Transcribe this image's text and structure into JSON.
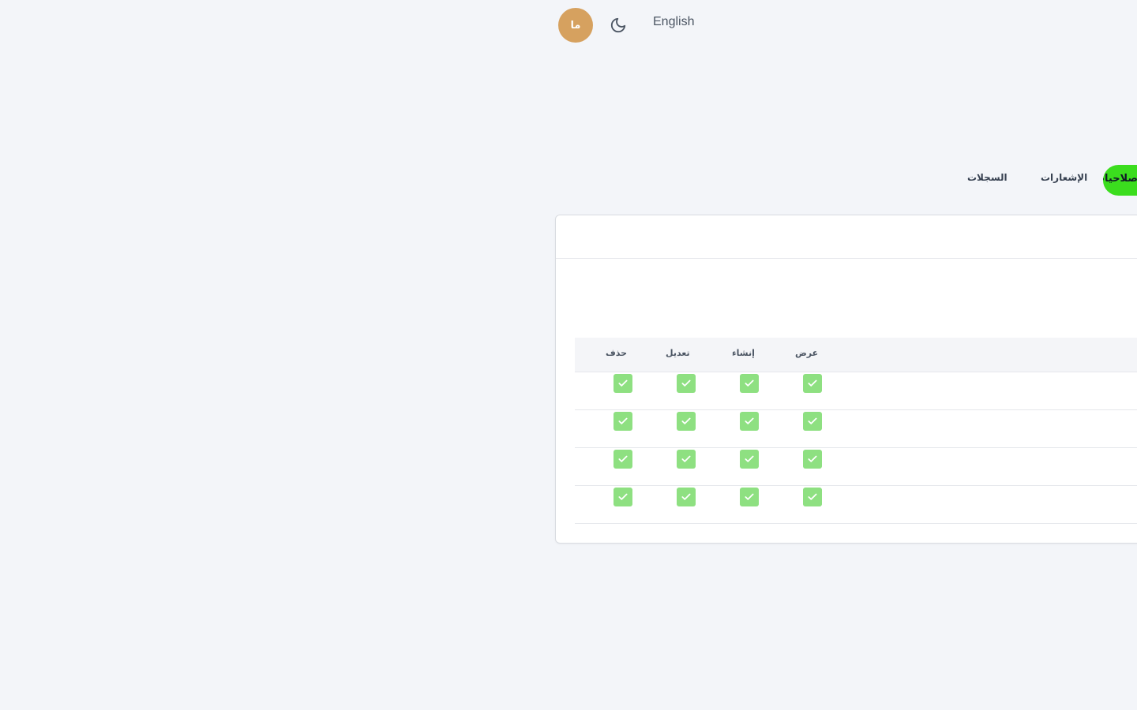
{
  "header": {
    "avatar_initials": "ما",
    "language_label": "English",
    "theme_icon": "moon-icon"
  },
  "tabs": [
    {
      "label": "السجلات",
      "active": false
    },
    {
      "label": "الإشعارات",
      "active": false
    },
    {
      "label": "صلاحيات",
      "active": true
    }
  ],
  "permissions_table": {
    "columns": [
      "عرض",
      "إنشاء",
      "تعديل",
      "حذف"
    ],
    "rows": [
      {
        "view": true,
        "create": true,
        "edit": true,
        "delete": true
      },
      {
        "view": true,
        "create": true,
        "edit": true,
        "delete": true
      },
      {
        "view": true,
        "create": true,
        "edit": true,
        "delete": true
      },
      {
        "view": true,
        "create": true,
        "edit": true,
        "delete": true
      }
    ]
  },
  "colors": {
    "accent": "#3bdd1e",
    "checkbox": "#8ee081",
    "avatar": "#d6a15f",
    "background": "#f3f5f9"
  }
}
